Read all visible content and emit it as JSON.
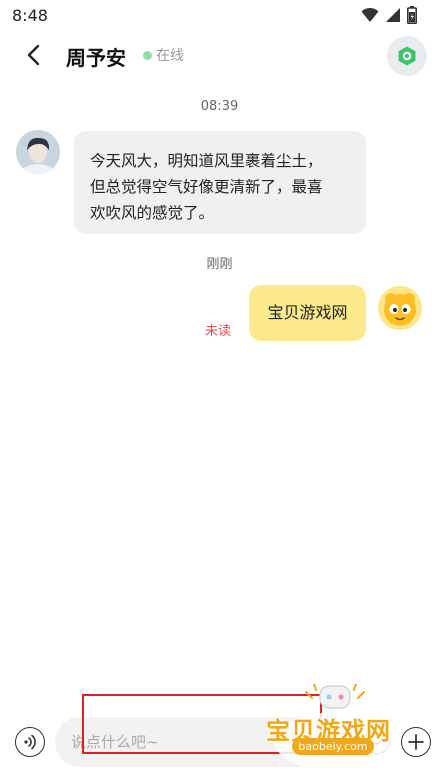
{
  "status_bar": {
    "time": "8:48",
    "icons": [
      "wifi-icon",
      "signal-icon",
      "battery-icon"
    ]
  },
  "header": {
    "title": "周予安",
    "online_status": "在线",
    "back_icon": "chevron-left-icon",
    "right_icon": "shield-icon",
    "online_color": "#8fe0a8"
  },
  "chat": {
    "messages": [
      {
        "timestamp": "08:39",
        "side": "left",
        "lines": [
          "今天风大，明知道风里裹着尘土，",
          "但总觉得空气好像更清新了，最喜",
          "欢吹风的感觉了。"
        ],
        "bubble_color": "#f0f0f0"
      },
      {
        "timestamp": "刚刚",
        "side": "right",
        "text": "宝贝游戏网",
        "status": "未读",
        "bubble_color": "#fbe98c"
      }
    ]
  },
  "input_bar": {
    "placeholder": "说点什么吧~",
    "value": "",
    "left_icon": "voice-icon",
    "right_icons": [
      "emoji-icon",
      "plus-icon"
    ]
  },
  "watermark": {
    "text": "宝贝游戏网",
    "url": "baobeiy.com",
    "color": "#f0a818"
  }
}
